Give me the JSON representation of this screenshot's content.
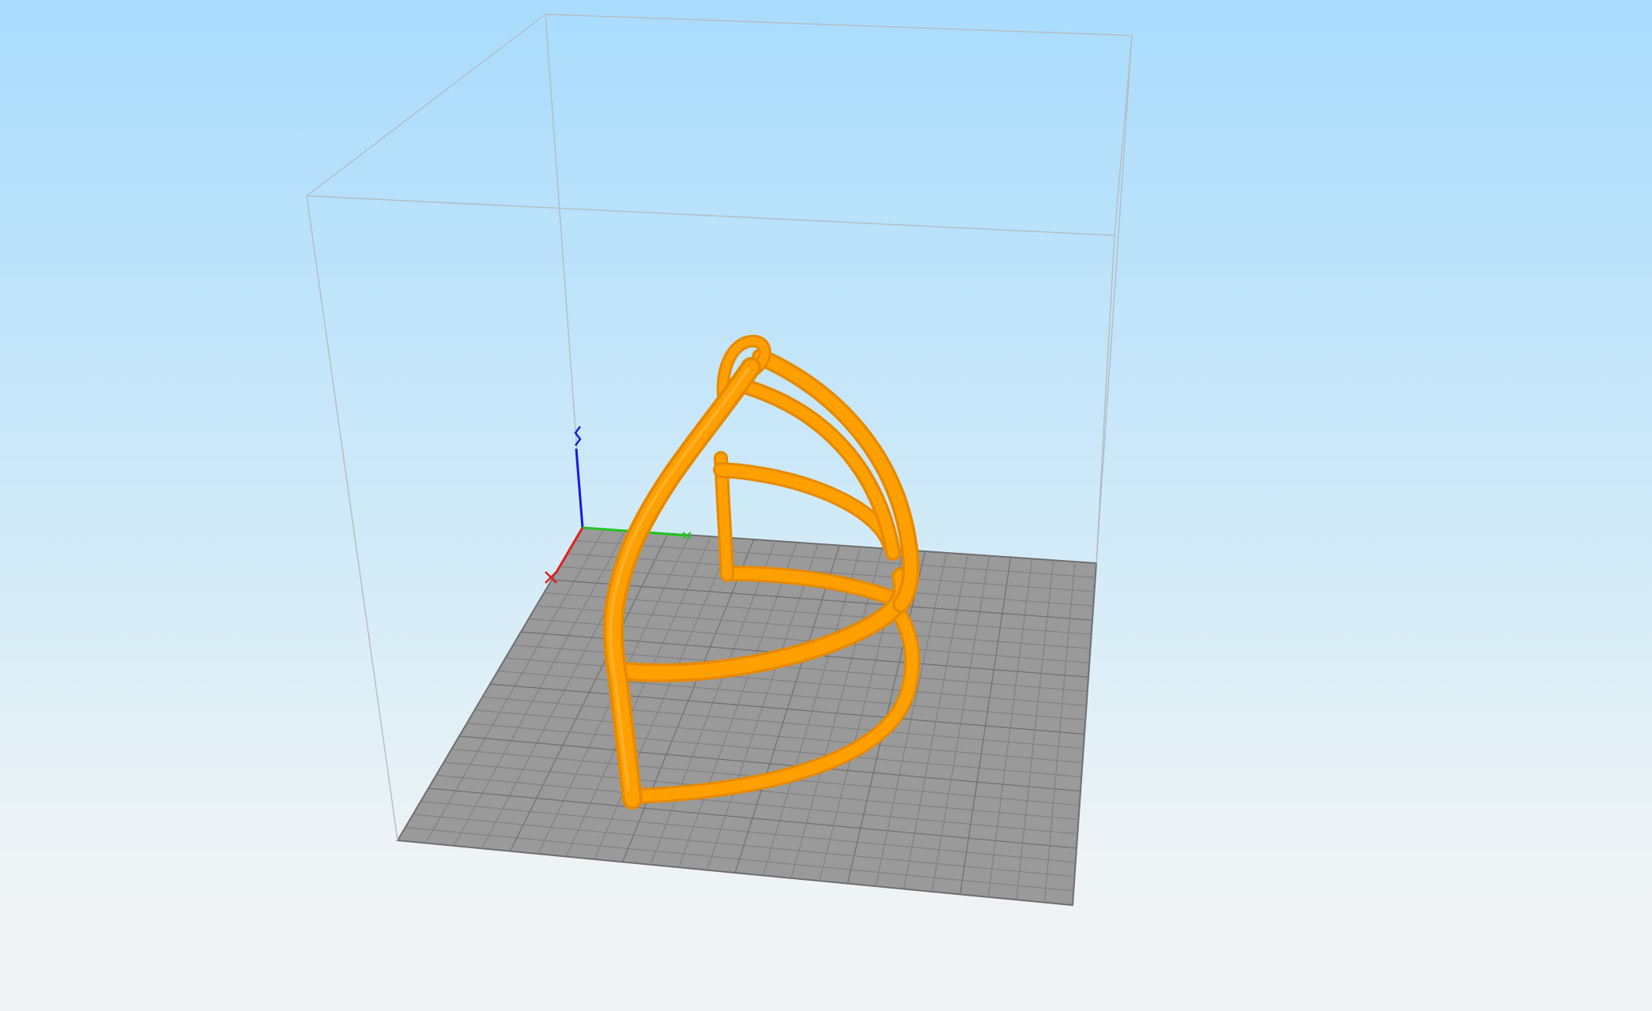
{
  "viewport": {
    "background_top": "#a9dcfd",
    "background_bottom": "#f1f3f4"
  },
  "build_volume": {
    "edge_color": "#b0b8bd"
  },
  "build_plate": {
    "color": "#9a9a9a",
    "grid_color": "#7c7c7c"
  },
  "model": {
    "color": "#ffa000",
    "shadow_color": "#e68a00"
  },
  "axes": {
    "x_color": "#e02020",
    "y_color": "#22c422",
    "z_color": "#1a1ad6"
  }
}
